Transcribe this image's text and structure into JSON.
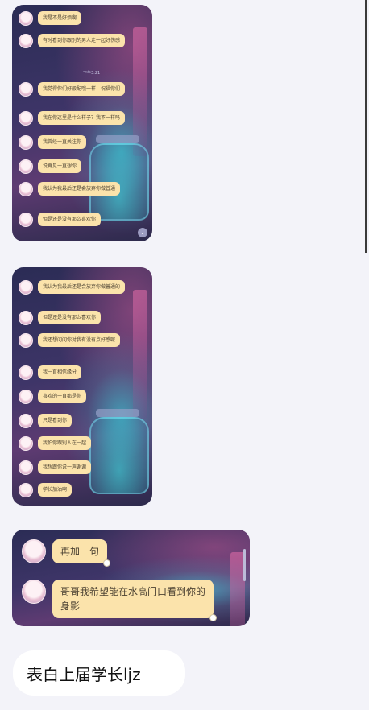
{
  "screenshot1": {
    "timestamp": "下午3:21",
    "messages": [
      "我是不是好烦啊",
      "有时看到你跟别的男人走一起好伤感",
      "我觉得你们好般配哦一样！祝福你们",
      "我在你这里是什么样子？我不一样吗",
      "我曾经一直关注你",
      "说再见一直想你",
      "我认为我最后还是会放弃你做普通",
      "但是还是没有那么喜欢你",
      "还是有点放不下"
    ]
  },
  "screenshot2": {
    "messages": [
      "我曾经在心中想",
      "我认为我最后还是会放弃你做普通的",
      "但是还是没有那么喜欢你",
      "我还想问问你对我有没有点好感呢",
      "我一直相信缘分",
      "喜欢的一直都是你",
      "只是看到你",
      "我怕你跟别人在一起",
      "我想跟你说一声谢谢",
      "学长加油啊"
    ]
  },
  "screenshot3": {
    "messages": [
      "再加一句",
      "哥哥我希望能在水高门口看到你的身影"
    ]
  },
  "caption": "表白上届学长ljz"
}
